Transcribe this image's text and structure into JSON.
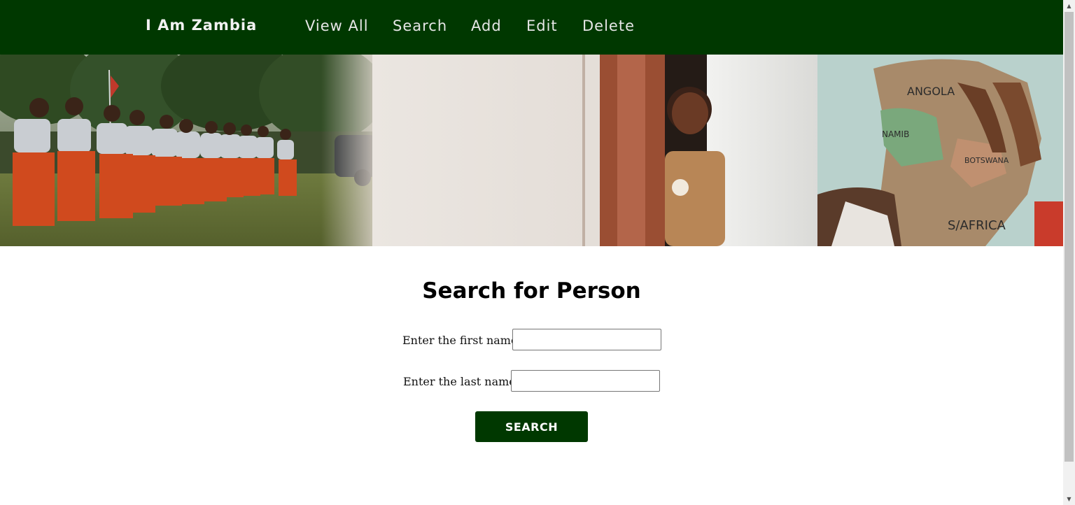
{
  "navbar": {
    "brand": "I Am Zambia",
    "links": [
      "View All",
      "Search",
      "Add",
      "Edit",
      "Delete"
    ],
    "background": "#003800"
  },
  "banner": {
    "images": [
      "dancers-photo",
      "child-in-doorway-photo",
      "hands-on-map-photo"
    ]
  },
  "form": {
    "title": "Search for Person",
    "first_name_label": "Enter the first name:",
    "first_name_value": "",
    "last_name_label": "Enter the last name:",
    "last_name_value": "",
    "submit_label": "SEARCH"
  },
  "scrollbar": {
    "up_icon": "▲",
    "down_icon": "▼"
  },
  "colors": {
    "accent": "#003800",
    "text": "#000000",
    "background": "#ffffff"
  }
}
